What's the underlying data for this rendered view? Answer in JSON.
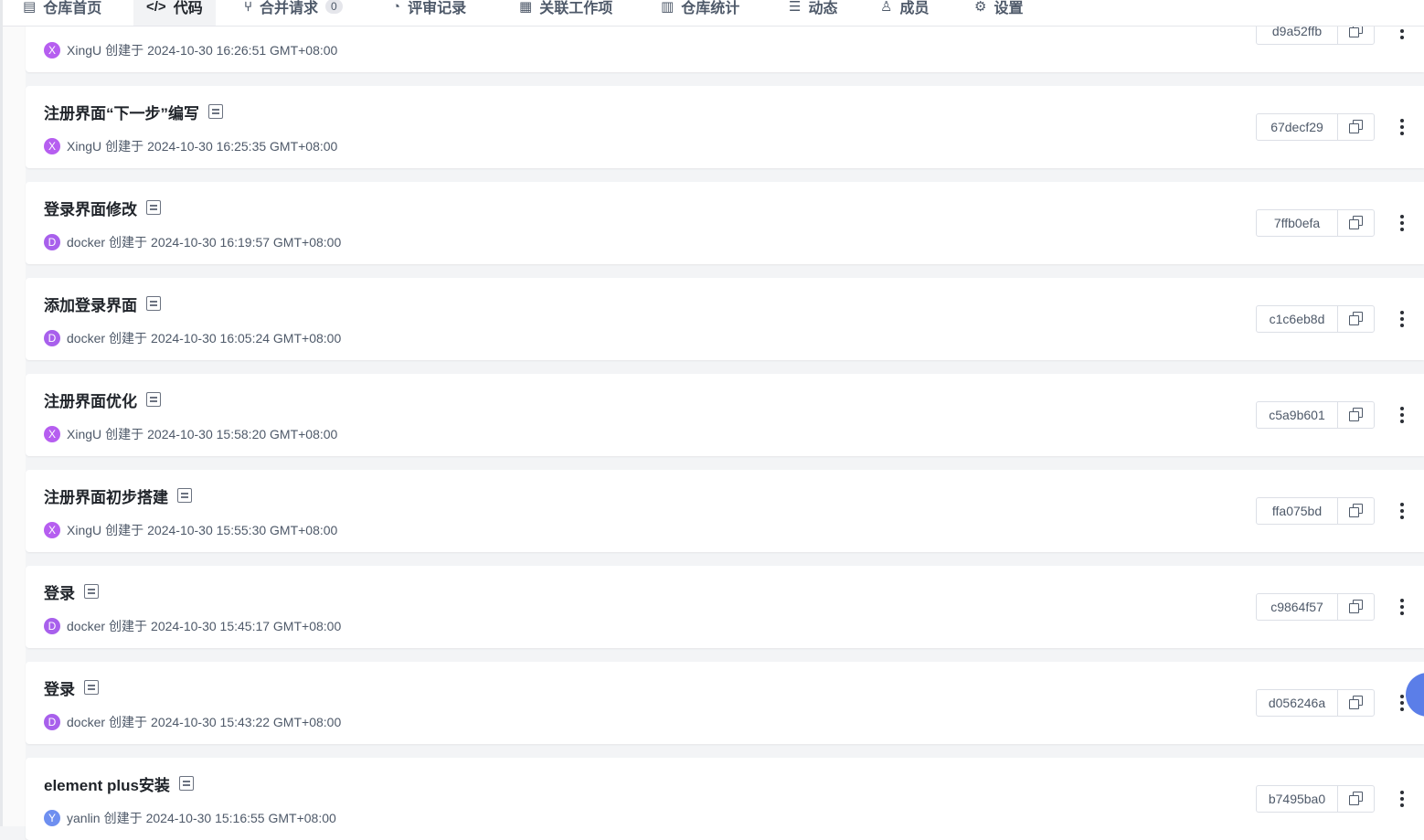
{
  "tabs": [
    {
      "label": "仓库首页",
      "icon": "doc-icon"
    },
    {
      "label": "代码",
      "icon": "code-icon",
      "active": true
    },
    {
      "label": "合并请求",
      "icon": "merge-icon",
      "badge": "0"
    },
    {
      "label": "评审记录",
      "icon": "review-icon"
    },
    {
      "label": "关联工作项",
      "icon": "workitem-icon"
    },
    {
      "label": "仓库统计",
      "icon": "chart-icon"
    },
    {
      "label": "动态",
      "icon": "list-icon"
    },
    {
      "label": "成员",
      "icon": "user-icon"
    },
    {
      "label": "设置",
      "icon": "gear-icon"
    }
  ],
  "created_label": "创建于",
  "commits": [
    {
      "title": "",
      "author": "XingU",
      "avatar": "X",
      "avatar_color": "#b65ef0",
      "time": "2024-10-30 16:26:51 GMT+08:00",
      "hash": "d9a52ffb"
    },
    {
      "title": "注册界面“下一步”编写",
      "author": "XingU",
      "avatar": "X",
      "avatar_color": "#b65ef0",
      "time": "2024-10-30 16:25:35 GMT+08:00",
      "hash": "67decf29"
    },
    {
      "title": "登录界面修改",
      "author": "docker",
      "avatar": "D",
      "avatar_color": "#a860ec",
      "time": "2024-10-30 16:19:57 GMT+08:00",
      "hash": "7ffb0efa"
    },
    {
      "title": "添加登录界面",
      "author": "docker",
      "avatar": "D",
      "avatar_color": "#a860ec",
      "time": "2024-10-30 16:05:24 GMT+08:00",
      "hash": "c1c6eb8d"
    },
    {
      "title": "注册界面优化",
      "author": "XingU",
      "avatar": "X",
      "avatar_color": "#b65ef0",
      "time": "2024-10-30 15:58:20 GMT+08:00",
      "hash": "c5a9b601"
    },
    {
      "title": "注册界面初步搭建",
      "author": "XingU",
      "avatar": "X",
      "avatar_color": "#b65ef0",
      "time": "2024-10-30 15:55:30 GMT+08:00",
      "hash": "ffa075bd"
    },
    {
      "title": "登录",
      "author": "docker",
      "avatar": "D",
      "avatar_color": "#a860ec",
      "time": "2024-10-30 15:45:17 GMT+08:00",
      "hash": "c9864f57"
    },
    {
      "title": "登录",
      "author": "docker",
      "avatar": "D",
      "avatar_color": "#a860ec",
      "time": "2024-10-30 15:43:22 GMT+08:00",
      "hash": "d056246a"
    },
    {
      "title": "element plus安装",
      "author": "yanlin",
      "avatar": "Y",
      "avatar_color": "#6e8ff0",
      "time": "2024-10-30 15:16:55 GMT+08:00",
      "hash": "b7495ba0"
    }
  ]
}
